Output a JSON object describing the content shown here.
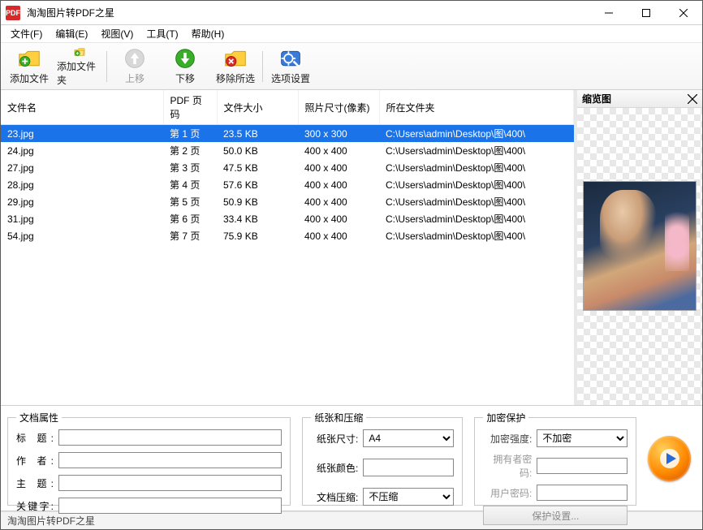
{
  "titlebar": {
    "app_badge": "PDF",
    "title": "淘淘图片转PDF之星"
  },
  "menubar": {
    "file": "文件(F)",
    "edit": "编辑(E)",
    "view": "视图(V)",
    "tools": "工具(T)",
    "help": "帮助(H)"
  },
  "toolbar": {
    "add_file": "添加文件",
    "add_folder": "添加文件夹",
    "move_up": "上移",
    "move_down": "下移",
    "remove_selected": "移除所选",
    "options": "选项设置"
  },
  "table": {
    "headers": {
      "name": "文件名",
      "page": "PDF 页码",
      "size": "文件大小",
      "dim": "照片尺寸(像素)",
      "folder": "所在文件夹"
    },
    "rows": [
      {
        "name": "23.jpg",
        "page": "第 1 页",
        "size": "23.5 KB",
        "dim": "300 x 300",
        "folder": "C:\\Users\\admin\\Desktop\\图\\400\\",
        "selected": true
      },
      {
        "name": "24.jpg",
        "page": "第 2 页",
        "size": "50.0 KB",
        "dim": "400 x 400",
        "folder": "C:\\Users\\admin\\Desktop\\图\\400\\"
      },
      {
        "name": "27.jpg",
        "page": "第 3 页",
        "size": "47.5 KB",
        "dim": "400 x 400",
        "folder": "C:\\Users\\admin\\Desktop\\图\\400\\"
      },
      {
        "name": "28.jpg",
        "page": "第 4 页",
        "size": "57.6 KB",
        "dim": "400 x 400",
        "folder": "C:\\Users\\admin\\Desktop\\图\\400\\"
      },
      {
        "name": "29.jpg",
        "page": "第 5 页",
        "size": "50.9 KB",
        "dim": "400 x 400",
        "folder": "C:\\Users\\admin\\Desktop\\图\\400\\"
      },
      {
        "name": "31.jpg",
        "page": "第 6 页",
        "size": "33.4 KB",
        "dim": "400 x 400",
        "folder": "C:\\Users\\admin\\Desktop\\图\\400\\"
      },
      {
        "name": "54.jpg",
        "page": "第 7 页",
        "size": "75.9 KB",
        "dim": "400 x 400",
        "folder": "C:\\Users\\admin\\Desktop\\图\\400\\"
      }
    ]
  },
  "preview": {
    "title": "缩览图"
  },
  "doc_props": {
    "legend": "文档属性",
    "title_lbl": "标 题:",
    "title_val": "",
    "author_lbl": "作 者:",
    "author_val": "",
    "subject_lbl": "主 题:",
    "subject_val": "",
    "keywords_lbl": "关键字:",
    "keywords_val": ""
  },
  "paper": {
    "legend": "纸张和压缩",
    "size_lbl": "纸张尺寸:",
    "size_val": "A4",
    "color_lbl": "纸张颜色:",
    "compress_lbl": "文档压缩:",
    "compress_val": "不压缩"
  },
  "encrypt": {
    "legend": "加密保护",
    "strength_lbl": "加密强度:",
    "strength_val": "不加密",
    "owner_lbl": "拥有者密码:",
    "owner_val": "",
    "user_lbl": "用户密码:",
    "user_val": "",
    "settings_btn": "保护设置..."
  },
  "status": {
    "text": "淘淘图片转PDF之星"
  }
}
